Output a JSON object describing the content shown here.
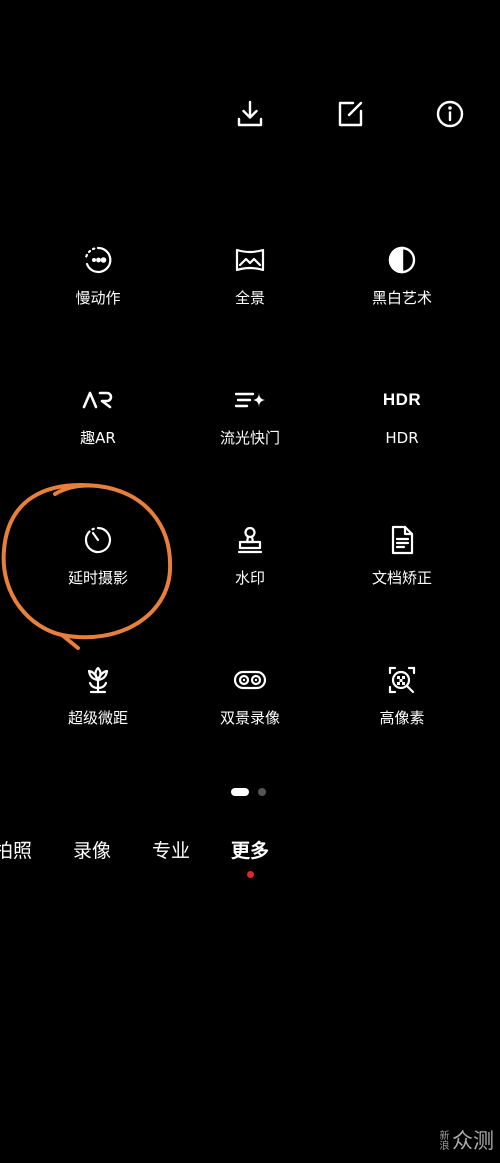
{
  "top_bar": {
    "download_icon": "download-icon",
    "edit_icon": "edit-icon",
    "info_icon": "info-icon"
  },
  "modes": [
    {
      "label": "慢动作",
      "icon": "slow-motion-icon"
    },
    {
      "label": "全景",
      "icon": "panorama-icon"
    },
    {
      "label": "黑白艺术",
      "icon": "black-white-icon"
    },
    {
      "label": "趣AR",
      "icon": "ar-icon"
    },
    {
      "label": "流光快门",
      "icon": "light-trail-shutter-icon"
    },
    {
      "label": "HDR",
      "icon": "hdr-icon",
      "glyph": "HDR"
    },
    {
      "label": "延时摄影",
      "icon": "timelapse-icon"
    },
    {
      "label": "水印",
      "icon": "watermark-stamp-icon"
    },
    {
      "label": "文档矫正",
      "icon": "document-icon"
    },
    {
      "label": "超级微距",
      "icon": "macro-flower-icon"
    },
    {
      "label": "双景录像",
      "icon": "dual-view-icon"
    },
    {
      "label": "高像素",
      "icon": "high-pixel-icon"
    }
  ],
  "pager": {
    "pages": 2,
    "current": 1
  },
  "tabs": [
    {
      "label": "拍照",
      "active": false
    },
    {
      "label": "录像",
      "active": false
    },
    {
      "label": "专业",
      "active": false
    },
    {
      "label": "更多",
      "active": true
    }
  ],
  "colors": {
    "background": "#000000",
    "annotation": "#e8803a",
    "active_indicator": "#e8212f"
  },
  "watermark": {
    "small": "新浪",
    "big": "众测"
  }
}
